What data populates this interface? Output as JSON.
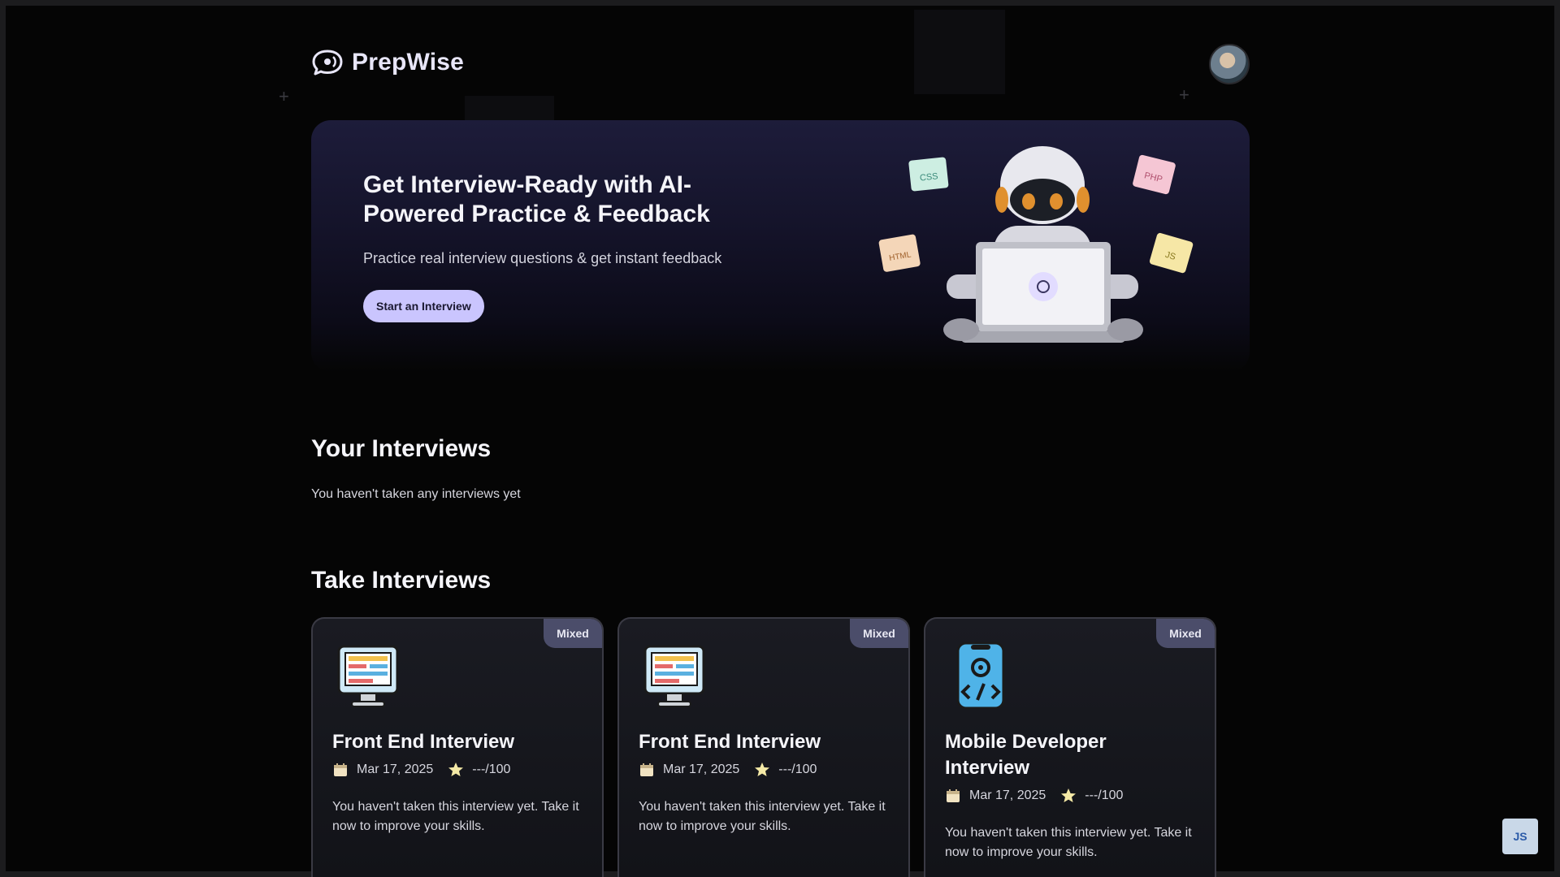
{
  "brand": {
    "name": "PrepWise"
  },
  "hero": {
    "title": "Get Interview-Ready with AI-Powered Practice & Feedback",
    "subtitle": "Practice real interview questions & get instant feedback",
    "button_label": "Start an Interview",
    "tech_stickers": [
      "CSS",
      "PHP",
      "HTML",
      "JS"
    ]
  },
  "your_interviews": {
    "title": "Your Interviews",
    "empty_text": "You haven't taken any interviews yet"
  },
  "take_interviews": {
    "title": "Take Interviews",
    "cards": [
      {
        "badge": "Mixed",
        "icon": "monitor-code-icon",
        "title": "Front End Interview",
        "date": "Mar 17, 2025",
        "score": "---/100",
        "description": "You haven't taken this interview yet. Take it now to improve your skills."
      },
      {
        "badge": "Mixed",
        "icon": "monitor-code-icon",
        "title": "Front End Interview",
        "date": "Mar 17, 2025",
        "score": "---/100",
        "description": "You haven't taken this interview yet. Take it now to improve your skills."
      },
      {
        "badge": "Mixed",
        "icon": "mobile-code-icon",
        "title": "Mobile Developer Interview",
        "date": "Mar 17, 2025",
        "score": "---/100",
        "description": "You haven't taken this interview yet. Take it now to improve your skills."
      }
    ]
  },
  "watermark": {
    "text": "JS"
  },
  "colors": {
    "accent": "#cac5fe",
    "badge": "#4b4d6a",
    "background": "#050505",
    "card": "#1a1b22"
  }
}
